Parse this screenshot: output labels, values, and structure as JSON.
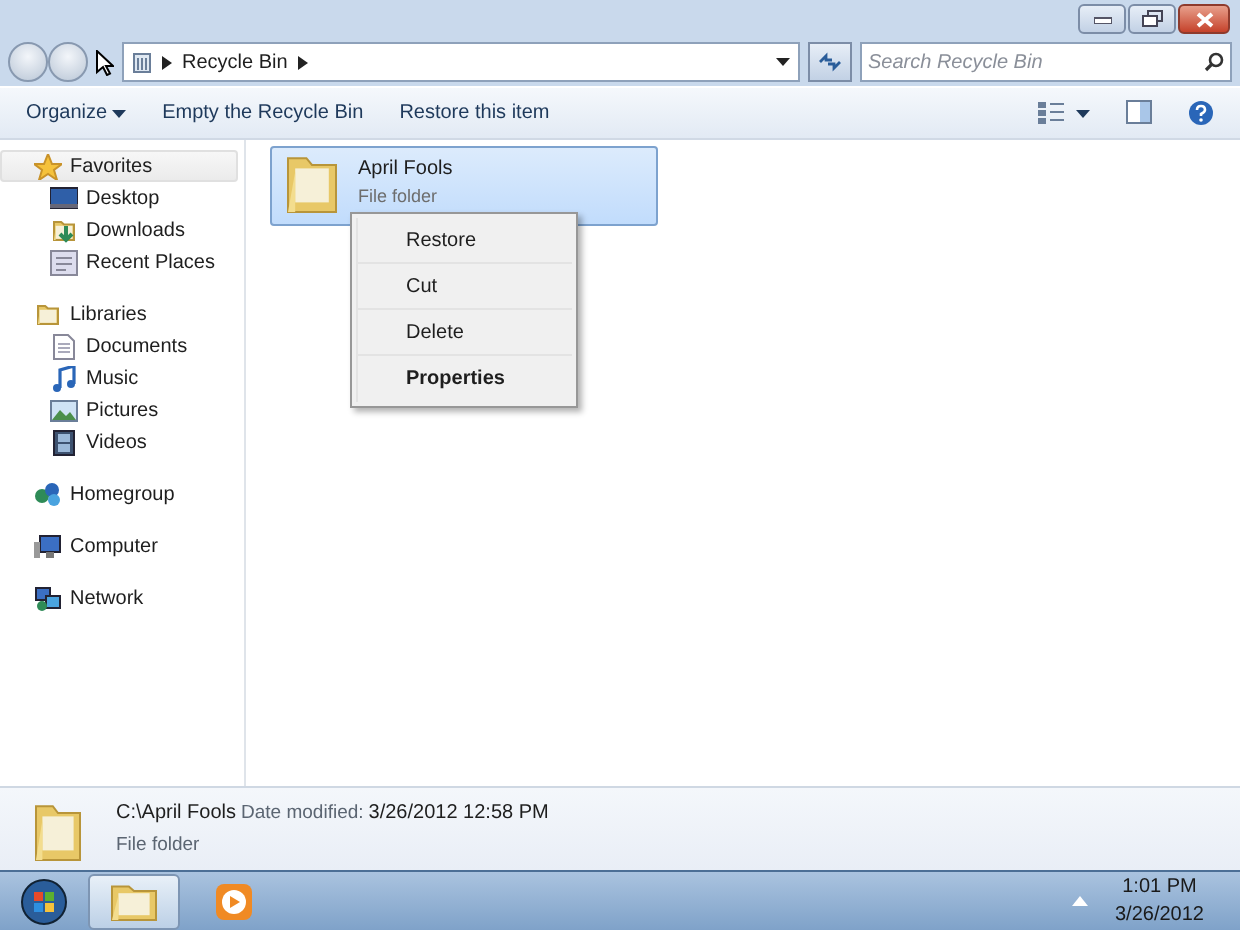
{
  "address_bar": {
    "segments": [
      "Recycle Bin"
    ]
  },
  "search": {
    "placeholder": "Search Recycle Bin"
  },
  "toolbar": {
    "commands": [
      {
        "label": "Organize",
        "dropdown": true
      },
      {
        "label": "Empty the Recycle Bin",
        "dropdown": false
      },
      {
        "label": "Restore this item",
        "dropdown": false
      }
    ]
  },
  "sidebar": {
    "groups": [
      {
        "label": "Favorites",
        "selected": true,
        "children": [
          {
            "label": "Desktop",
            "selected": false
          },
          {
            "label": "Downloads",
            "selected": false
          },
          {
            "label": "Recent Places",
            "selected": false
          }
        ]
      },
      {
        "label": "Libraries",
        "selected": false,
        "children": [
          {
            "label": "Documents",
            "selected": false
          },
          {
            "label": "Music",
            "selected": false
          },
          {
            "label": "Pictures",
            "selected": false
          },
          {
            "label": "Videos",
            "selected": false
          }
        ]
      },
      {
        "label": "Homegroup",
        "selected": false
      },
      {
        "label": "Computer",
        "selected": false
      },
      {
        "label": "Network",
        "selected": false
      }
    ]
  },
  "files": [
    {
      "name": "April Fools",
      "type": "File folder",
      "selected": true
    }
  ],
  "context_menu": {
    "items": [
      {
        "label": "Restore",
        "default": false
      },
      {
        "label": "Cut",
        "default": false
      },
      {
        "label": "Delete",
        "default": false
      },
      {
        "label": "Properties",
        "default": true
      }
    ]
  },
  "details": {
    "path": "C:\\April Fools",
    "date_label": "Date modified:",
    "date": "3/26/2012 12:58 PM",
    "type": "File folder"
  },
  "taskbar": {
    "buttons": [
      {
        "kind": "explorer",
        "selected": true
      },
      {
        "kind": "media",
        "selected": false
      }
    ],
    "time": "1:01 PM",
    "date": "3/26/2012"
  }
}
